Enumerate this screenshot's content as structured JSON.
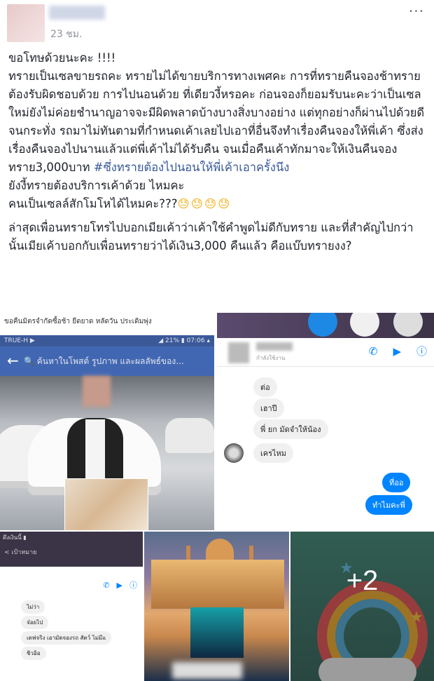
{
  "post": {
    "timestamp": "23 ชม.",
    "more_icon": "···",
    "text": {
      "line1": "ขอโทษด้วยนะคะ !!!!",
      "para1": "ทรายเป็นเซลขายรถคะ ทรายไม่ได้ขายบริการทางเพศคะ การที่ทรายคืนจองช้าทรายต้องรับผิดชอบด้วย การไปนอนด้วย ที่เดียวงี้หรอคะ ก่อนจองก็ยอมรับนะคะว่าเป็นเซลใหม่ยังไม่ค่อยชำนาญอาจจะมีผิดพลาดบ้างบางสิ่งบางอย่าง แต่ทุกอย่างก็ผ่านไปด้วยดีจนกระทั่ง รถมาไม่ทันตามที่กำหนดเค้าเลยไปเอาที่อื่นจึงทำเรื่องคืนจองให้พี่เค้า ซึ่งส่งเรื่องคืนจองไปนานแล้วแต่พี่เค้าไม่ได้รับคืน จนเมื่อคืนเค้าทักมาจะให้เงินคืนจองทราย3,000บาท ",
      "hashtag": "#ซึ่งทรายต้องไปนอนให้พี่เค้าเอาครั้งนึง",
      "line3": "ยังงี้ทรายต้องบริการเค้าด้วย ไหมคะ",
      "line4": "คนเป็นเซลล์สักโมโหได้ไหมคะ???",
      "emoji": "😓😓😓😓",
      "para2": "ล่าสุดเพื่อนทรายโทรไปบอกเมียเค้าว่าเค้าใช้คำพูดไม่ดีกับทราย และที่สำคัญไปกว่านั้นเมียเค้าบอกกับเพื่อนทรายว่าได้เงิน3,000 คืนแล้ว คือแบ๊บทรายงง?"
    }
  },
  "photos": {
    "tile1": {
      "caption": "ขอคืนมิตรจำกัดซื้อช้า ยืดยาด หลัดวัน ประเดิมพุ่ง",
      "status_left": "TRUE-H ▶",
      "status_right": "◢ 21% ▮ 07:06 ▴",
      "back_icon": "←",
      "search_placeholder": "🔍 ค้นหาในโพสต์ รูปภาพ และผลลัพธ์ของ..."
    },
    "tile2": {
      "subtitle": "กำลังใช้งาน",
      "icons": [
        "phone-icon",
        "video-icon",
        "info-icon"
      ],
      "icon_glyphs": [
        "✆",
        "▶",
        "ⓘ"
      ],
      "messages_in": [
        "ต่อ",
        "เฮาปี",
        "พี่ ยก มัดจำให้น้อง",
        "เครไหม"
      ],
      "messages_out": [
        "ที่ออ",
        "ทำไมคะพี่"
      ]
    },
    "tile3": {
      "status": "ดึงเงินนี้ ▮",
      "back": "< เป้าหมาย",
      "icons": [
        "✆",
        "▶",
        "ⓘ"
      ],
      "messages": [
        "ไม่ว่า",
        "จ๋อยไป",
        "เดฟจริง เอามัดจองรถ สัตว์ ไม่มีแ",
        "ชิวอิอ"
      ]
    },
    "more_count": "+2"
  }
}
